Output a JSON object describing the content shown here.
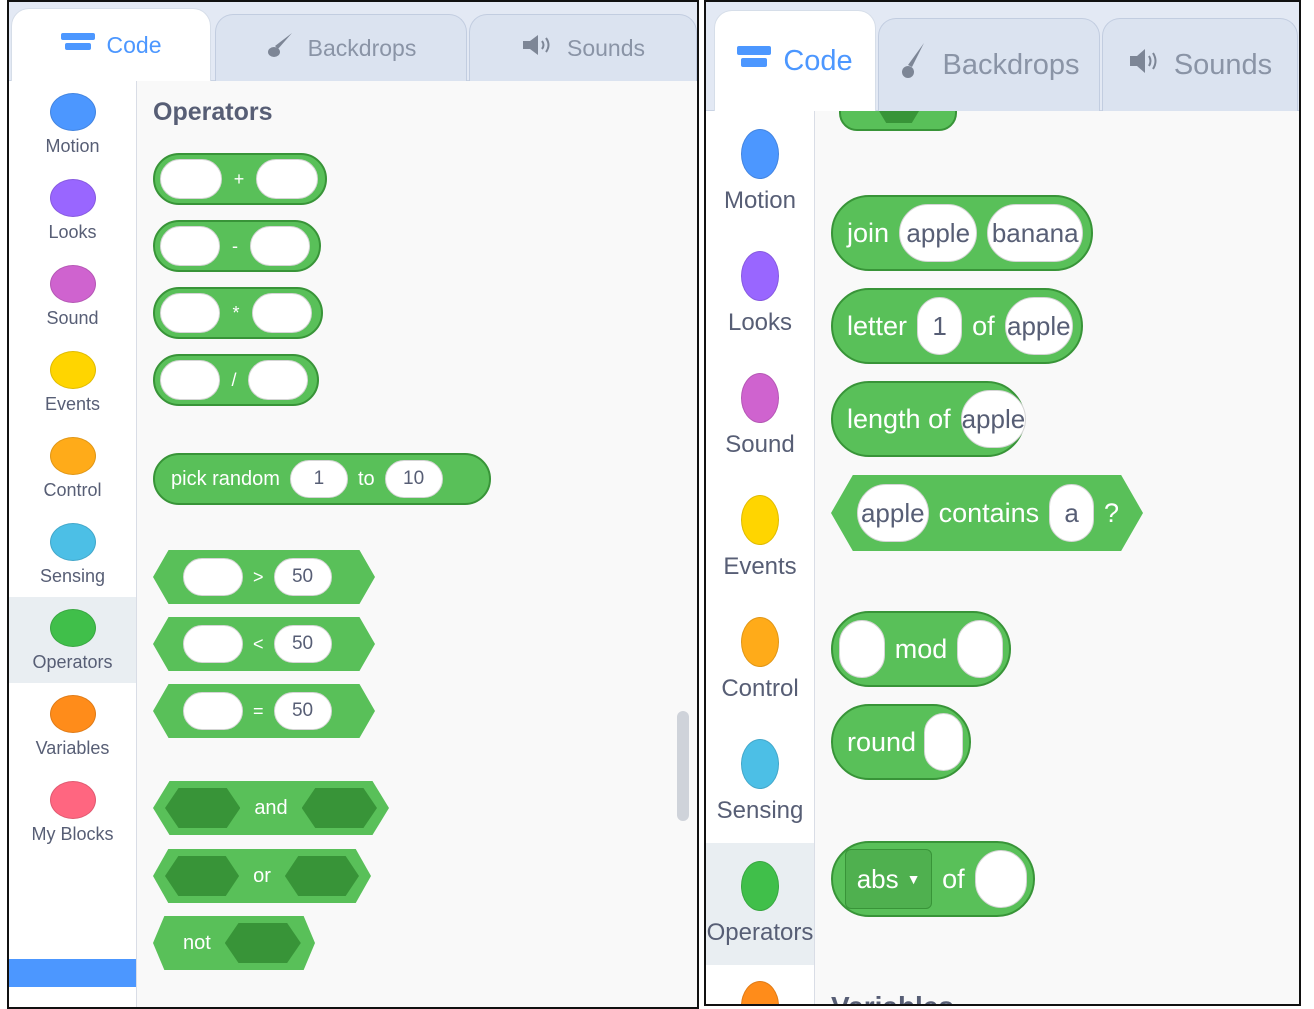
{
  "tabs": {
    "code": "Code",
    "backdrops": "Backdrops",
    "sounds": "Sounds"
  },
  "categories": {
    "motion": {
      "label": "Motion",
      "color": "#4c97ff"
    },
    "looks": {
      "label": "Looks",
      "color": "#9966ff"
    },
    "sound": {
      "label": "Sound",
      "color": "#cf63cf"
    },
    "events": {
      "label": "Events",
      "color": "#ffd500"
    },
    "control": {
      "label": "Control",
      "color": "#ffab19"
    },
    "sensing": {
      "label": "Sensing",
      "color": "#4cbfe6"
    },
    "operators": {
      "label": "Operators",
      "color": "#40bf4a"
    },
    "variables": {
      "label": "Variables",
      "color": "#ff8c1a"
    },
    "myblocks": {
      "label": "My Blocks",
      "color": "#ff6680"
    }
  },
  "left": {
    "heading": "Operators",
    "add_op": "+",
    "sub_op": "-",
    "mul_op": "*",
    "div_op": "/",
    "random": {
      "label": "pick random",
      "from": "1",
      "to_label": "to",
      "to": "10"
    },
    "gt": {
      "op": ">",
      "value": "50"
    },
    "lt": {
      "op": "<",
      "value": "50"
    },
    "eq": {
      "op": "=",
      "value": "50"
    },
    "and_label": "and",
    "or_label": "or",
    "not_label": "not"
  },
  "right": {
    "join": {
      "label": "join",
      "a": "apple",
      "b": "banana"
    },
    "letter": {
      "label": "letter",
      "index": "1",
      "of": "of",
      "text": "apple"
    },
    "length": {
      "label": "length of",
      "text": "apple"
    },
    "contains": {
      "text": "apple",
      "label": "contains",
      "sub": "a",
      "q": "?"
    },
    "mod_label": "mod",
    "round_label": "round",
    "abs": {
      "option": "abs",
      "of": "of"
    },
    "next_heading": "Variables"
  },
  "colors": {
    "operators_block": "#59c059",
    "operators_border": "#389438",
    "accent": "#4c97ff"
  }
}
